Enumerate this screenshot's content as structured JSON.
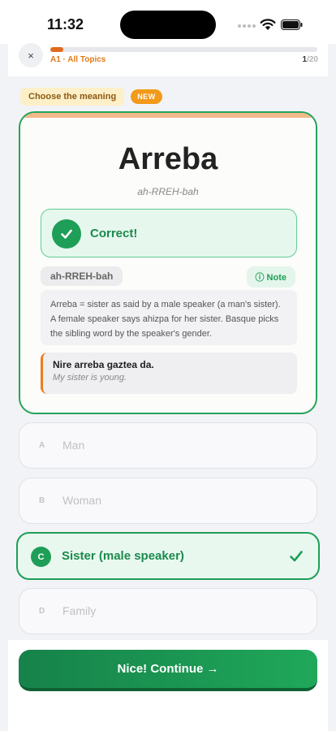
{
  "status_bar": {
    "time": "11:32"
  },
  "header": {
    "close_label": "×",
    "topic": "A1 · All Topics",
    "progress_current": "1",
    "progress_total": "/20",
    "progress_fraction": 0.05
  },
  "badges": {
    "task": "Choose the meaning",
    "new": "NEW"
  },
  "card": {
    "word": "Arreba",
    "phonetic": "ah-RREH-bah",
    "result": "Correct!",
    "pronunciation": "ah-RREH-bah",
    "note_label": "ⓘ Note",
    "explanation": "Arreba = sister as said by a male speaker (a man's sister). A female speaker says ahizpa for her sister. Basque picks the sibling word by the speaker's gender.",
    "example_eu": "Nire arreba gaztea da.",
    "example_en": "My sister is young."
  },
  "options": [
    {
      "letter": "A",
      "text": "Man"
    },
    {
      "letter": "B",
      "text": "Woman"
    },
    {
      "letter": "C",
      "text": "Sister (male speaker)"
    },
    {
      "letter": "D",
      "text": "Family"
    }
  ],
  "continue_label": "Nice! Continue →",
  "colors": {
    "accent_green": "#1e9e57",
    "accent_orange": "#e26a1c",
    "badge_new": "#f29a1a"
  }
}
